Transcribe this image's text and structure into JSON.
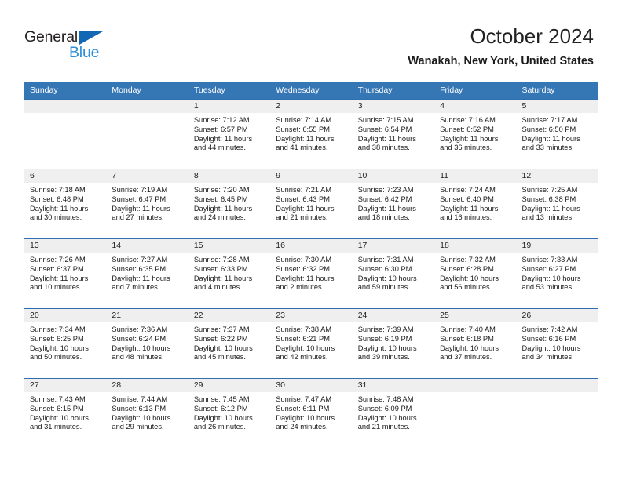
{
  "brand": {
    "name_part1": "General",
    "name_part2": "Blue",
    "accent_color": "#2e8fd8",
    "triangle_color": "#1268b3"
  },
  "header": {
    "title": "October 2024",
    "subtitle": "Wanakah, New York, United States"
  },
  "theme": {
    "header_row_bg": "#3576b5",
    "row_divider": "#2f6fae",
    "daynum_band_bg": "#efefef"
  },
  "weekday_headers": [
    "Sunday",
    "Monday",
    "Tuesday",
    "Wednesday",
    "Thursday",
    "Friday",
    "Saturday"
  ],
  "weeks": [
    [
      {
        "day": "",
        "info": ""
      },
      {
        "day": "",
        "info": ""
      },
      {
        "day": "1",
        "info": "Sunrise: 7:12 AM\nSunset: 6:57 PM\nDaylight: 11 hours and 44 minutes."
      },
      {
        "day": "2",
        "info": "Sunrise: 7:14 AM\nSunset: 6:55 PM\nDaylight: 11 hours and 41 minutes."
      },
      {
        "day": "3",
        "info": "Sunrise: 7:15 AM\nSunset: 6:54 PM\nDaylight: 11 hours and 38 minutes."
      },
      {
        "day": "4",
        "info": "Sunrise: 7:16 AM\nSunset: 6:52 PM\nDaylight: 11 hours and 36 minutes."
      },
      {
        "day": "5",
        "info": "Sunrise: 7:17 AM\nSunset: 6:50 PM\nDaylight: 11 hours and 33 minutes."
      }
    ],
    [
      {
        "day": "6",
        "info": "Sunrise: 7:18 AM\nSunset: 6:48 PM\nDaylight: 11 hours and 30 minutes."
      },
      {
        "day": "7",
        "info": "Sunrise: 7:19 AM\nSunset: 6:47 PM\nDaylight: 11 hours and 27 minutes."
      },
      {
        "day": "8",
        "info": "Sunrise: 7:20 AM\nSunset: 6:45 PM\nDaylight: 11 hours and 24 minutes."
      },
      {
        "day": "9",
        "info": "Sunrise: 7:21 AM\nSunset: 6:43 PM\nDaylight: 11 hours and 21 minutes."
      },
      {
        "day": "10",
        "info": "Sunrise: 7:23 AM\nSunset: 6:42 PM\nDaylight: 11 hours and 18 minutes."
      },
      {
        "day": "11",
        "info": "Sunrise: 7:24 AM\nSunset: 6:40 PM\nDaylight: 11 hours and 16 minutes."
      },
      {
        "day": "12",
        "info": "Sunrise: 7:25 AM\nSunset: 6:38 PM\nDaylight: 11 hours and 13 minutes."
      }
    ],
    [
      {
        "day": "13",
        "info": "Sunrise: 7:26 AM\nSunset: 6:37 PM\nDaylight: 11 hours and 10 minutes."
      },
      {
        "day": "14",
        "info": "Sunrise: 7:27 AM\nSunset: 6:35 PM\nDaylight: 11 hours and 7 minutes."
      },
      {
        "day": "15",
        "info": "Sunrise: 7:28 AM\nSunset: 6:33 PM\nDaylight: 11 hours and 4 minutes."
      },
      {
        "day": "16",
        "info": "Sunrise: 7:30 AM\nSunset: 6:32 PM\nDaylight: 11 hours and 2 minutes."
      },
      {
        "day": "17",
        "info": "Sunrise: 7:31 AM\nSunset: 6:30 PM\nDaylight: 10 hours and 59 minutes."
      },
      {
        "day": "18",
        "info": "Sunrise: 7:32 AM\nSunset: 6:28 PM\nDaylight: 10 hours and 56 minutes."
      },
      {
        "day": "19",
        "info": "Sunrise: 7:33 AM\nSunset: 6:27 PM\nDaylight: 10 hours and 53 minutes."
      }
    ],
    [
      {
        "day": "20",
        "info": "Sunrise: 7:34 AM\nSunset: 6:25 PM\nDaylight: 10 hours and 50 minutes."
      },
      {
        "day": "21",
        "info": "Sunrise: 7:36 AM\nSunset: 6:24 PM\nDaylight: 10 hours and 48 minutes."
      },
      {
        "day": "22",
        "info": "Sunrise: 7:37 AM\nSunset: 6:22 PM\nDaylight: 10 hours and 45 minutes."
      },
      {
        "day": "23",
        "info": "Sunrise: 7:38 AM\nSunset: 6:21 PM\nDaylight: 10 hours and 42 minutes."
      },
      {
        "day": "24",
        "info": "Sunrise: 7:39 AM\nSunset: 6:19 PM\nDaylight: 10 hours and 39 minutes."
      },
      {
        "day": "25",
        "info": "Sunrise: 7:40 AM\nSunset: 6:18 PM\nDaylight: 10 hours and 37 minutes."
      },
      {
        "day": "26",
        "info": "Sunrise: 7:42 AM\nSunset: 6:16 PM\nDaylight: 10 hours and 34 minutes."
      }
    ],
    [
      {
        "day": "27",
        "info": "Sunrise: 7:43 AM\nSunset: 6:15 PM\nDaylight: 10 hours and 31 minutes."
      },
      {
        "day": "28",
        "info": "Sunrise: 7:44 AM\nSunset: 6:13 PM\nDaylight: 10 hours and 29 minutes."
      },
      {
        "day": "29",
        "info": "Sunrise: 7:45 AM\nSunset: 6:12 PM\nDaylight: 10 hours and 26 minutes."
      },
      {
        "day": "30",
        "info": "Sunrise: 7:47 AM\nSunset: 6:11 PM\nDaylight: 10 hours and 24 minutes."
      },
      {
        "day": "31",
        "info": "Sunrise: 7:48 AM\nSunset: 6:09 PM\nDaylight: 10 hours and 21 minutes."
      },
      {
        "day": "",
        "info": ""
      },
      {
        "day": "",
        "info": ""
      }
    ]
  ]
}
